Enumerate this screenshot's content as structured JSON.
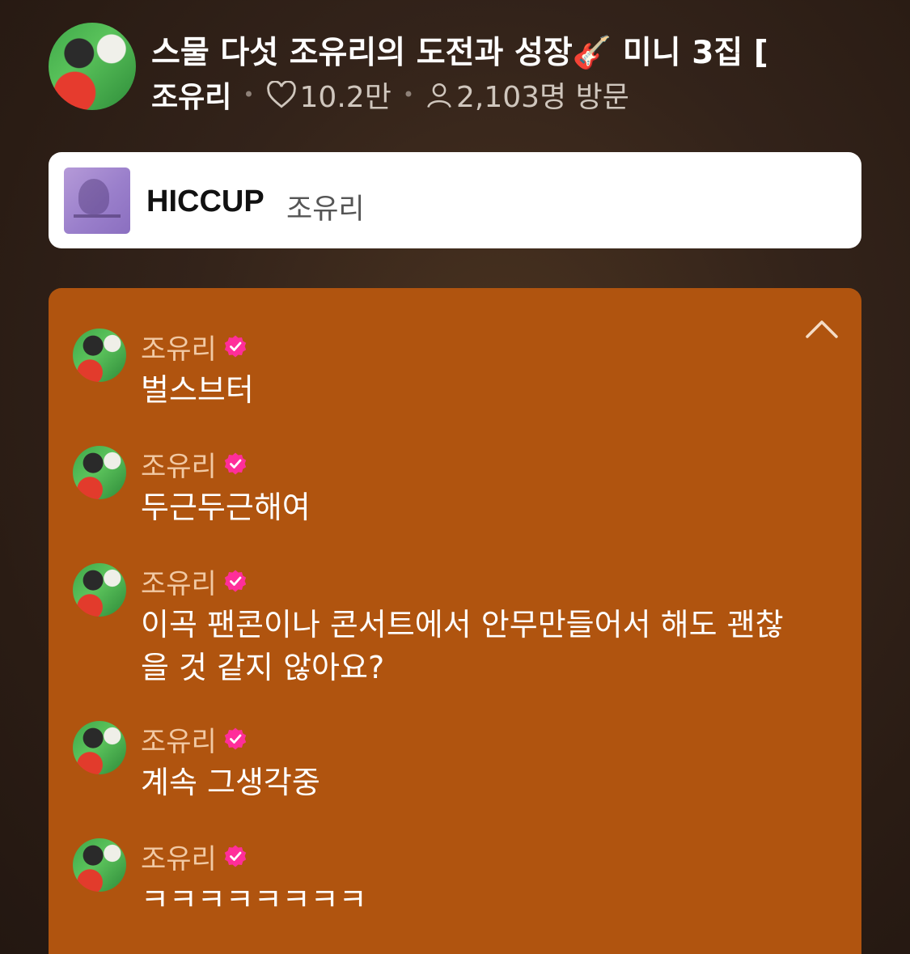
{
  "header": {
    "title": "스물 다섯 조유리의 도전과 성장🎸 미니 3집 [",
    "author": "조유리",
    "likes": "10.2만",
    "visitors": "2,103명 방문"
  },
  "track": {
    "title": "HICCUP",
    "artist": "조유리"
  },
  "messages": [
    {
      "name": "조유리",
      "text": "벌스브터"
    },
    {
      "name": "조유리",
      "text": "두근두근해여"
    },
    {
      "name": "조유리",
      "text": "이곡 팬콘이나 콘서트에서 안무만들어서 해도 괜찮을 것 같지 않아요?"
    },
    {
      "name": "조유리",
      "text": "계속 그생각중"
    },
    {
      "name": "조유리",
      "text": "ㅋㅋㅋㅋㅋㅋㅋㅋ"
    }
  ],
  "icons": {
    "heart": "heart-icon",
    "person": "person-icon",
    "verified": "verified-badge-icon",
    "collapse": "chevron-up-icon"
  },
  "colors": {
    "panel": "#b0540f",
    "verified": "#ff2e9a",
    "name": "#f1c9a4"
  }
}
